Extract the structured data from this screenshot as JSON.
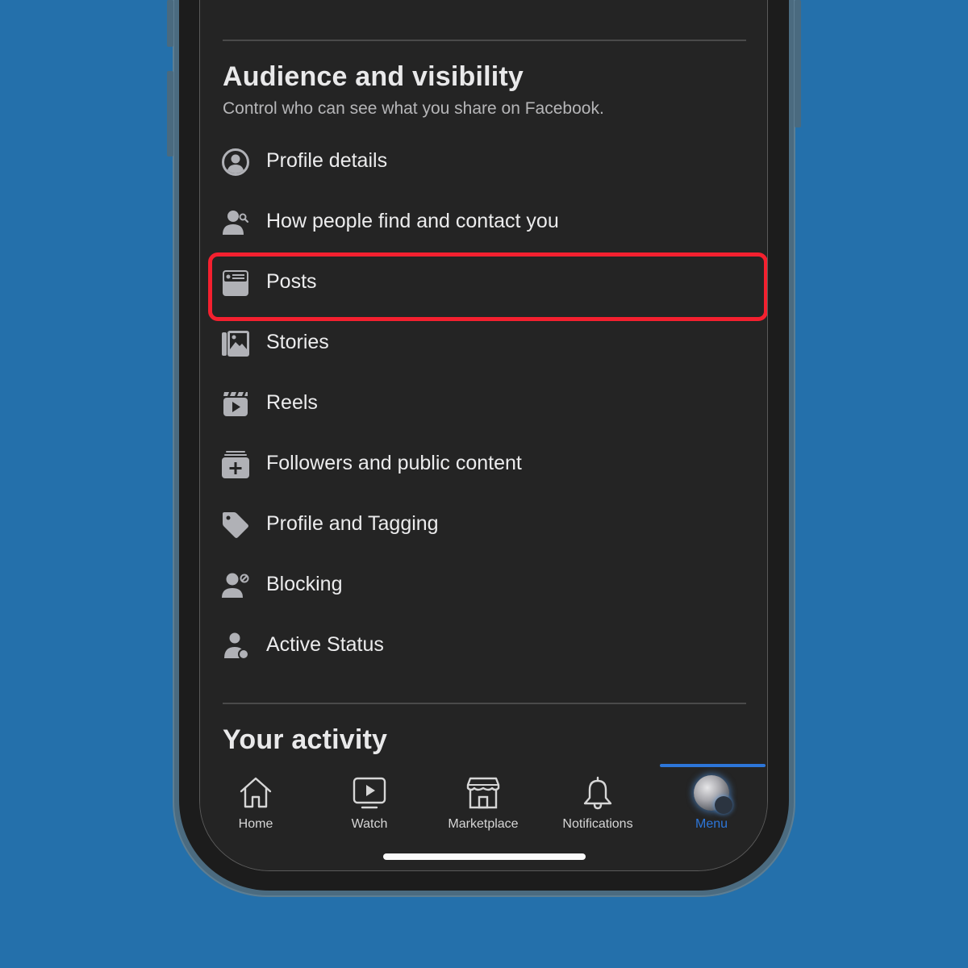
{
  "colors": {
    "background": "#2470ab",
    "screen": "#242424",
    "highlight": "#f4202f",
    "accent": "#2d76d9",
    "icon": "#b0b1b6"
  },
  "section_audience": {
    "title": "Audience and visibility",
    "subtitle": "Control who can see what you share on Facebook.",
    "items": [
      {
        "label": "Profile details",
        "icon": "profile-circle-icon"
      },
      {
        "label": "How people find and contact you",
        "icon": "person-search-icon"
      },
      {
        "label": "Posts",
        "icon": "posts-card-icon",
        "highlighted": true
      },
      {
        "label": "Stories",
        "icon": "stories-photo-icon"
      },
      {
        "label": "Reels",
        "icon": "reels-clapper-icon"
      },
      {
        "label": "Followers and public content",
        "icon": "followers-add-icon"
      },
      {
        "label": "Profile and Tagging",
        "icon": "tag-icon"
      },
      {
        "label": "Blocking",
        "icon": "person-block-icon"
      },
      {
        "label": "Active Status",
        "icon": "person-status-icon"
      }
    ]
  },
  "section_activity": {
    "title": "Your activity"
  },
  "tabbar": {
    "tabs": [
      {
        "label": "Home",
        "icon": "home-icon"
      },
      {
        "label": "Watch",
        "icon": "watch-icon"
      },
      {
        "label": "Marketplace",
        "icon": "marketplace-icon"
      },
      {
        "label": "Notifications",
        "icon": "bell-icon"
      },
      {
        "label": "Menu",
        "icon": "avatar",
        "active": true
      }
    ]
  }
}
